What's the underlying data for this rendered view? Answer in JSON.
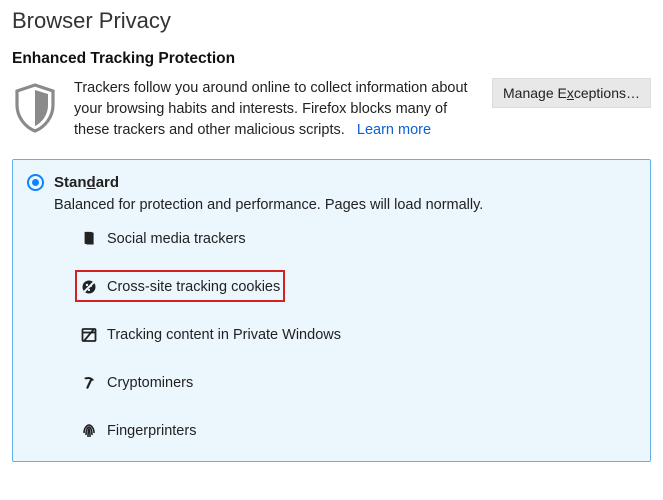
{
  "page_title": "Browser Privacy",
  "section_title": "Enhanced Tracking Protection",
  "intro": {
    "text": "Trackers follow you around online to collect information about your browsing habits and interests. Firefox blocks many of these trackers and other malicious scripts.",
    "learn_more": "Learn more"
  },
  "manage_exceptions": {
    "prefix": "Manage E",
    "key": "x",
    "suffix": "ceptions…"
  },
  "option": {
    "label_prefix": "Stan",
    "label_key": "d",
    "label_suffix": "ard",
    "description": "Balanced for protection and performance. Pages will load normally."
  },
  "items": [
    {
      "label": "Social media trackers",
      "icon": "thumbs",
      "highlight": false
    },
    {
      "label": "Cross-site tracking cookies",
      "icon": "cookie",
      "highlight": true
    },
    {
      "label": "Tracking content in Private Windows",
      "icon": "window",
      "highlight": false
    },
    {
      "label": "Cryptominers",
      "icon": "pickaxe",
      "highlight": false
    },
    {
      "label": "Fingerprinters",
      "icon": "fingerprint",
      "highlight": false
    }
  ]
}
